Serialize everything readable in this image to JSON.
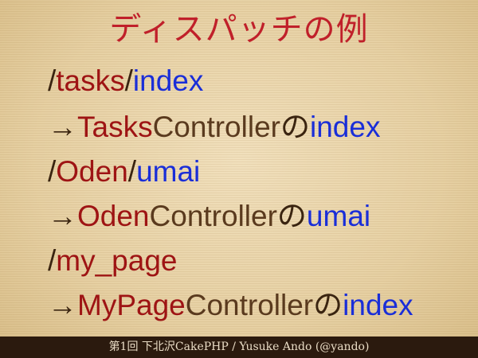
{
  "title": "ディスパッチの例",
  "lines": [
    {
      "segments": [
        "/",
        "tasks",
        "/",
        "index"
      ]
    },
    {
      "segments": [
        "→",
        "Tasks",
        "Controller",
        "の",
        "index"
      ]
    },
    {
      "segments": [
        "/",
        "Oden",
        "/",
        "umai"
      ]
    },
    {
      "segments": [
        "→",
        "Oden",
        "Controller",
        "の",
        "umai"
      ]
    },
    {
      "segments": [
        "/",
        "my_page"
      ]
    },
    {
      "segments": [
        "→",
        "MyPage",
        "Controller",
        "の",
        "index"
      ]
    }
  ],
  "footer": "第1回 下北沢CakePHP / Yusuke Ando (@yando)",
  "colors": {
    "title": "#c0202a",
    "route_red": "#9e1414",
    "action_blue": "#1a2ed8",
    "controller_brown": "#5a3a1e",
    "footer_bg": "#2b1a0e"
  }
}
